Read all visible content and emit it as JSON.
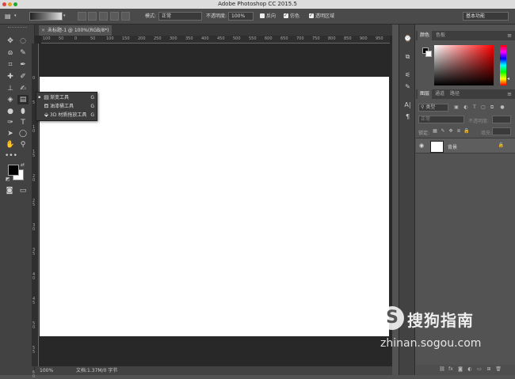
{
  "titlebar": {
    "title": "Adobe Photoshop CC 2015.5"
  },
  "options_bar": {
    "mode_label": "模式:",
    "mode_value": "正常",
    "opacity_label": "不透明度:",
    "opacity_value": "100%",
    "reverse_label": "反向",
    "dither_label": "仿色",
    "transparency_label": "透明区域",
    "workspace_value": "基本功能"
  },
  "document": {
    "tab_label": "未标题-1 @ 100%(RGB/8*)",
    "ruler_top": [
      "100",
      "50",
      "0",
      "50",
      "100",
      "150",
      "200",
      "250",
      "300",
      "350",
      "400",
      "450",
      "500",
      "550",
      "600",
      "650",
      "700",
      "750",
      "800",
      "850",
      "900",
      "950"
    ],
    "ruler_left": [
      "0",
      "5",
      "1 0",
      "1 5",
      "2 0",
      "2 5",
      "3 0",
      "3 5",
      "4 0",
      "4 5",
      "5 0",
      "5 5",
      "6 0"
    ]
  },
  "tool_popup": {
    "items": [
      {
        "label": "渐变工具",
        "key": "G",
        "icon": "gradient-icon"
      },
      {
        "label": "油漆桶工具",
        "key": "G",
        "icon": "paint-bucket-icon"
      },
      {
        "label": "3D 材质拖放工具",
        "key": "G",
        "icon": "3d-material-drop-icon"
      }
    ]
  },
  "status_bar": {
    "zoom": "100%",
    "doc_info": "文档:1.37M/0 字节"
  },
  "color_panel": {
    "tabs": [
      "颜色",
      "色板"
    ]
  },
  "layers_panel": {
    "tabs": [
      "图层",
      "通道",
      "路径"
    ],
    "filter_label": "类型",
    "blend_mode": "正常",
    "opacity_label": "不透明度:",
    "lock_label": "锁定:",
    "fill_label": "填充:",
    "layer_name": "背景"
  },
  "watermark": {
    "brand": "搜狗指南",
    "url": "zhinan.sogou.com"
  },
  "colors": {
    "accent": "#ff0000",
    "panel_bg": "#535353",
    "dark_bg": "#282828"
  }
}
